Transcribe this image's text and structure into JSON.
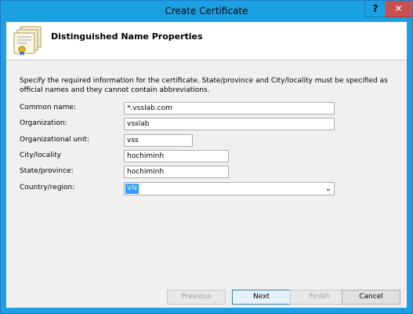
{
  "window": {
    "title": "Create Certificate",
    "help_label": "?",
    "close_label": "✕"
  },
  "header": {
    "title": "Distinguished Name Properties",
    "icon": "certificate-icon"
  },
  "description": "Specify the required information for the certificate. State/province and City/locality must be specified as official names and they cannot contain abbreviations.",
  "fields": {
    "common_name": {
      "label": "Common name:",
      "value": "*.vsslab.com"
    },
    "organization": {
      "label": "Organization:",
      "value": "vsslab"
    },
    "organizational_unit": {
      "label": "Organizational unit:",
      "value": "vss"
    },
    "city": {
      "label": "City/locality",
      "value": "hochiminh"
    },
    "state": {
      "label": "State/province:",
      "value": "hochiminh"
    },
    "country": {
      "label": "Country/region:",
      "value": "VN",
      "icon": "chevron-down-icon"
    }
  },
  "buttons": {
    "previous": "Previous",
    "next": "Next",
    "finish": "Finish",
    "cancel": "Cancel"
  },
  "colors": {
    "titlebar": "#1ba1e2",
    "close": "#c75050",
    "selection": "#3399ff"
  }
}
